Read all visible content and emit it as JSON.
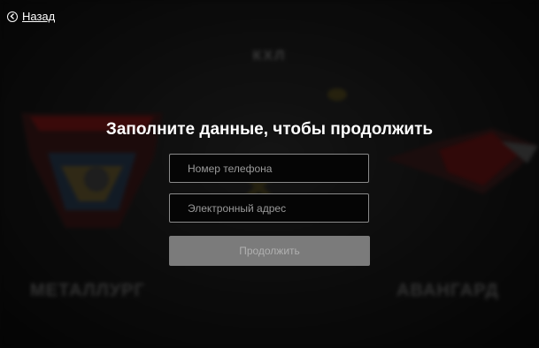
{
  "nav": {
    "back_label": "Назад",
    "back_icon": "chevron-left-icon"
  },
  "form": {
    "title": "Заполните данные, чтобы продолжить",
    "phone_placeholder": "Номер телефона",
    "email_placeholder": "Электронный адрес",
    "submit_label": "Продолжить"
  },
  "background": {
    "league": "КХЛ",
    "team_left": "МЕТАЛЛУРГ",
    "team_right": "АВАНГАРД"
  },
  "colors": {
    "background": "#0b0b0b",
    "field_border": "#8a8a8a",
    "button_disabled": "#7b7b7b",
    "text": "#ffffff"
  }
}
